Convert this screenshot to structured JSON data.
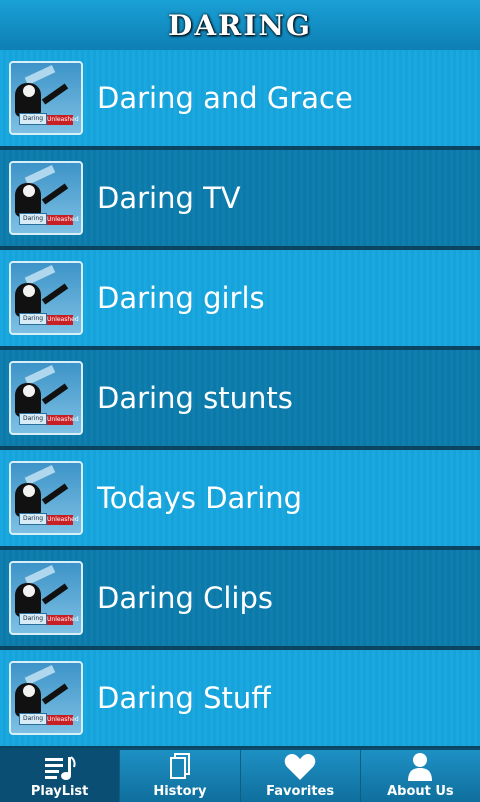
{
  "header": {
    "title": "DARING"
  },
  "playlists": [
    {
      "title": "Daring and Grace",
      "thumb_tag_left": "Daring",
      "thumb_tag_right": "Unleashed"
    },
    {
      "title": "Daring TV",
      "thumb_tag_left": "Daring",
      "thumb_tag_right": "Unleashed"
    },
    {
      "title": "Daring girls",
      "thumb_tag_left": "Daring",
      "thumb_tag_right": "Unleashed"
    },
    {
      "title": "Daring stunts",
      "thumb_tag_left": "Daring",
      "thumb_tag_right": "Unleashed"
    },
    {
      "title": "Todays Daring",
      "thumb_tag_left": "Daring",
      "thumb_tag_right": "Unleashed"
    },
    {
      "title": "Daring Clips",
      "thumb_tag_left": "Daring",
      "thumb_tag_right": "Unleashed"
    },
    {
      "title": "Daring Stuff",
      "thumb_tag_left": "Daring",
      "thumb_tag_right": "Unleashed"
    }
  ],
  "tabs": [
    {
      "label": "PlayList",
      "icon": "playlist-icon",
      "active": true
    },
    {
      "label": "History",
      "icon": "history-icon",
      "active": false
    },
    {
      "label": "Favorites",
      "icon": "heart-icon",
      "active": false
    },
    {
      "label": "About Us",
      "icon": "person-icon",
      "active": false
    }
  ],
  "colors": {
    "header": "#1aa0d6",
    "row_light": "#1aa8e0",
    "row_dark": "#0f7fb0",
    "active_tab": "#0a4f73"
  }
}
